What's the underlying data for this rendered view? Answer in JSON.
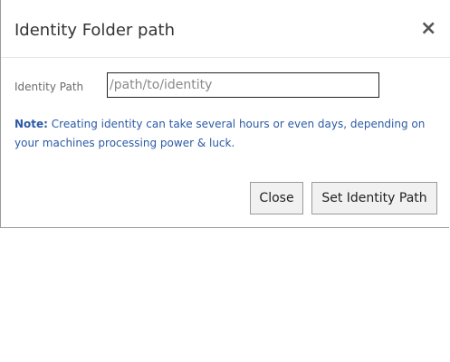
{
  "dialog": {
    "title": "Identity Folder path",
    "close_icon": "×"
  },
  "form": {
    "label": "Identity Path",
    "input_placeholder": "/path/to/identity",
    "input_value": ""
  },
  "note": {
    "label": "Note:",
    "text": " Creating identity can take several hours or even days, depending on your machines processing power & luck."
  },
  "buttons": {
    "close_label": "Close",
    "set_label": "Set Identity Path"
  },
  "colors": {
    "note_text": "#2b5aa5",
    "button_bg": "#f1f1f1"
  }
}
